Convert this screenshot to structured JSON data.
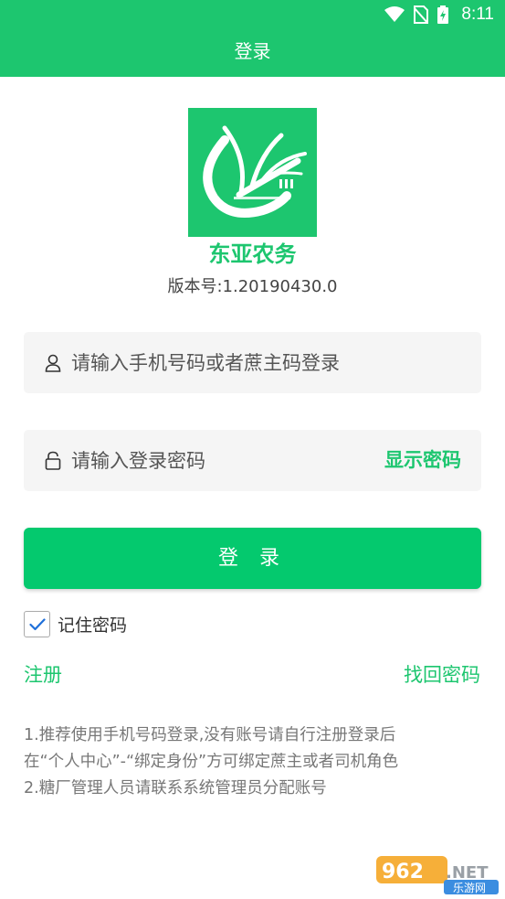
{
  "status_bar": {
    "time": "8:11"
  },
  "app_bar": {
    "title": "登录"
  },
  "app": {
    "name": "东亚农务",
    "version": "版本号:1.20190430.0"
  },
  "login_form": {
    "phone_placeholder": "请输入手机号码或者蔗主码登录",
    "password_placeholder": "请输入登录密码",
    "show_password_label": "显示密码",
    "login_button_label": "登 录",
    "remember_label": "记住密码",
    "remember_checked": true
  },
  "links": {
    "register": "注册",
    "forgot_password": "找回密码"
  },
  "notes": [
    "1.推荐使用手机号码登录,没有账号请自行注册登录后",
    "在“个人中心”-“绑定身份”方可绑定蔗主或者司机角色",
    "2.糖厂管理人员请联系系统管理员分配账号"
  ],
  "watermark": {
    "text": "962.NET",
    "subtext": "乐游网"
  },
  "colors": {
    "primary": "#1dc66f",
    "button": "#04c96e",
    "field_bg": "#f5f5f5"
  }
}
